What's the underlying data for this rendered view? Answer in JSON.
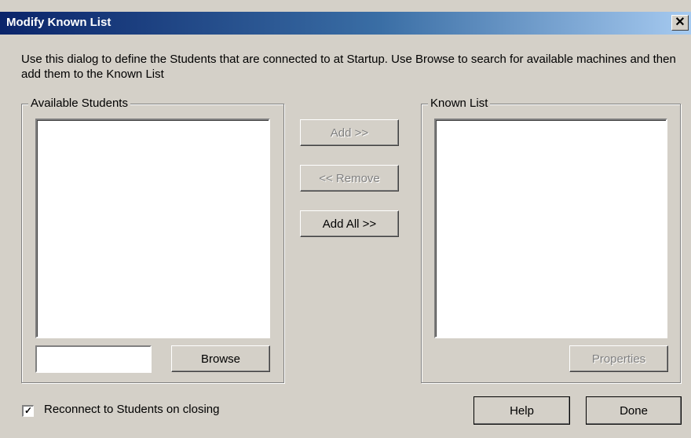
{
  "window": {
    "title": "Modify Known List",
    "close_glyph": "✕"
  },
  "description": "Use this dialog to define the Students that are connected to at Startup. Use Browse to search for available machines and then add them to the Known List",
  "available": {
    "label": "Available Students",
    "browse_label": "Browse",
    "input_value": ""
  },
  "middle_buttons": {
    "add": "Add >>",
    "remove": "<< Remove",
    "add_all": "Add All >>"
  },
  "known": {
    "label": "Known List",
    "properties_label": "Properties"
  },
  "reconnect": {
    "label": "Reconnect to Students on closing",
    "checked": true,
    "check_glyph": "✓"
  },
  "footer": {
    "help_label": "Help",
    "done_label": "Done"
  }
}
